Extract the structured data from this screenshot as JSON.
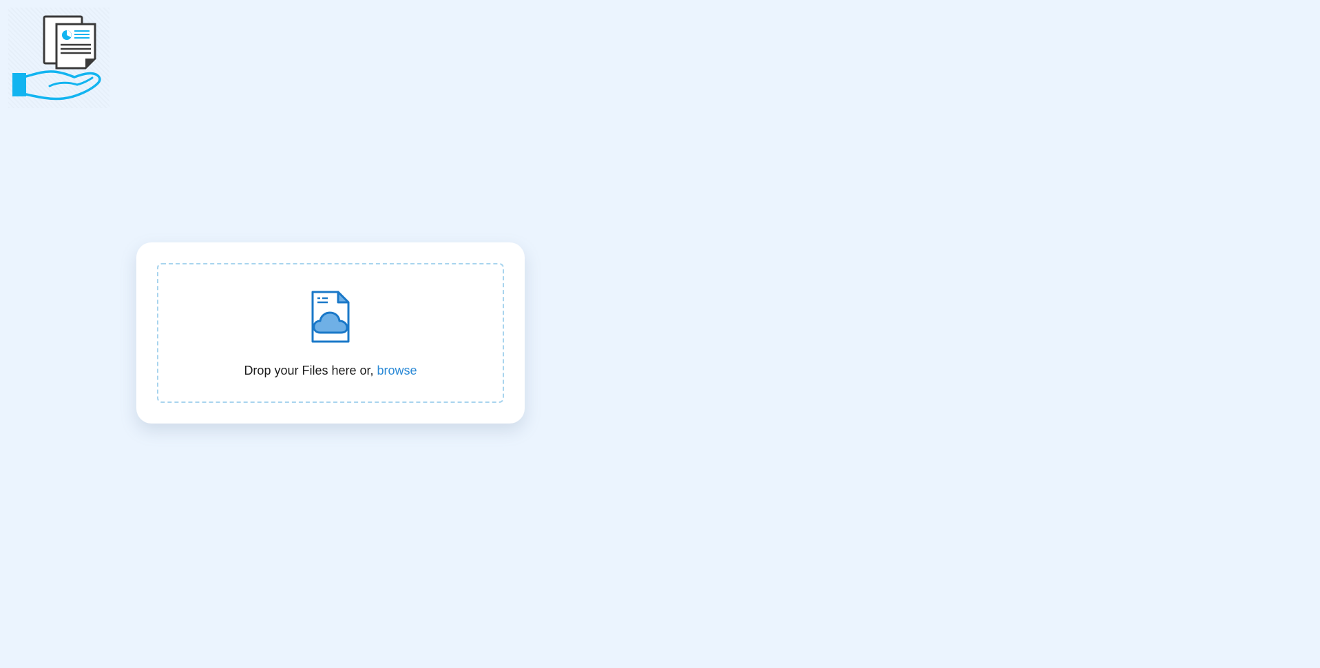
{
  "logo": {
    "icon": "hand-holding-documents-icon"
  },
  "upload": {
    "icon": "file-cloud-upload-icon",
    "prompt": "Drop your Files here or, ",
    "browse_label": "browse"
  },
  "colors": {
    "background": "#ebf4fe",
    "card": "#ffffff",
    "dropzone_border": "#a8d4ee",
    "link": "#2c8ad6",
    "icon_stroke": "#1a78c8",
    "icon_fill": "#6fb0e6",
    "logo_accent": "#12b4f0"
  }
}
